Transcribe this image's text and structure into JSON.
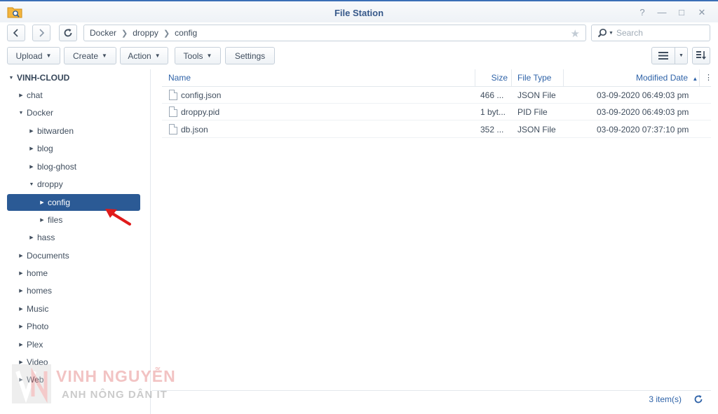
{
  "window": {
    "title": "File Station",
    "accent": "#3a6fb6",
    "controls": [
      "help-icon",
      "minimize-icon",
      "maximize-icon",
      "close-icon"
    ]
  },
  "address": {
    "breadcrumbs": [
      "Docker",
      "droppy",
      "config"
    ],
    "search_placeholder": "Search"
  },
  "toolbar": {
    "upload": "Upload",
    "create": "Create",
    "action": "Action",
    "tools": "Tools",
    "settings": "Settings"
  },
  "sidebar": {
    "root": "VINH-CLOUD",
    "selected_color": "#2b5a95",
    "items": [
      {
        "label": "chat"
      },
      {
        "label": "Docker"
      },
      {
        "label": "bitwarden"
      },
      {
        "label": "blog"
      },
      {
        "label": "blog-ghost"
      },
      {
        "label": "droppy"
      },
      {
        "label": "config"
      },
      {
        "label": "files"
      },
      {
        "label": "hass"
      },
      {
        "label": "Documents"
      },
      {
        "label": "home"
      },
      {
        "label": "homes"
      },
      {
        "label": "Music"
      },
      {
        "label": "Photo"
      },
      {
        "label": "Plex"
      },
      {
        "label": "Video"
      },
      {
        "label": "Web"
      }
    ]
  },
  "file_list": {
    "columns": {
      "name": "Name",
      "size": "Size",
      "type": "File Type",
      "modified": "Modified Date"
    },
    "rows": [
      {
        "name": "config.json",
        "size": "466 ...",
        "type": "JSON File",
        "modified": "03-09-2020 06:49:03 pm"
      },
      {
        "name": "droppy.pid",
        "size": "1 byt...",
        "type": "PID File",
        "modified": "03-09-2020 06:49:03 pm"
      },
      {
        "name": "db.json",
        "size": "352 ...",
        "type": "JSON File",
        "modified": "03-09-2020 07:37:10 pm"
      }
    ]
  },
  "footer": {
    "item_count": "3 item(s)"
  },
  "watermark": {
    "name": "VINH NGUYỄN",
    "subtitle": "ANH NÔNG DÂN IT"
  }
}
